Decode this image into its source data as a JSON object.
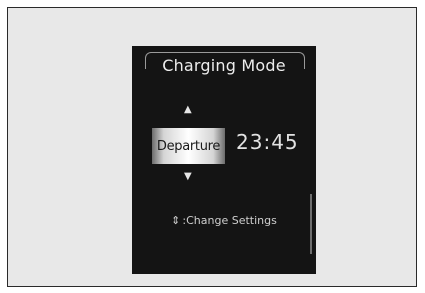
{
  "screen": {
    "title": "Charging Mode",
    "departure_label": "Departure",
    "time": "23:45",
    "hint_icon": "⇕",
    "hint_text": ":Change Settings"
  },
  "icons": {
    "up": "up-arrow-icon",
    "down": "down-arrow-icon",
    "hint": "up-down-arrows-icon"
  }
}
